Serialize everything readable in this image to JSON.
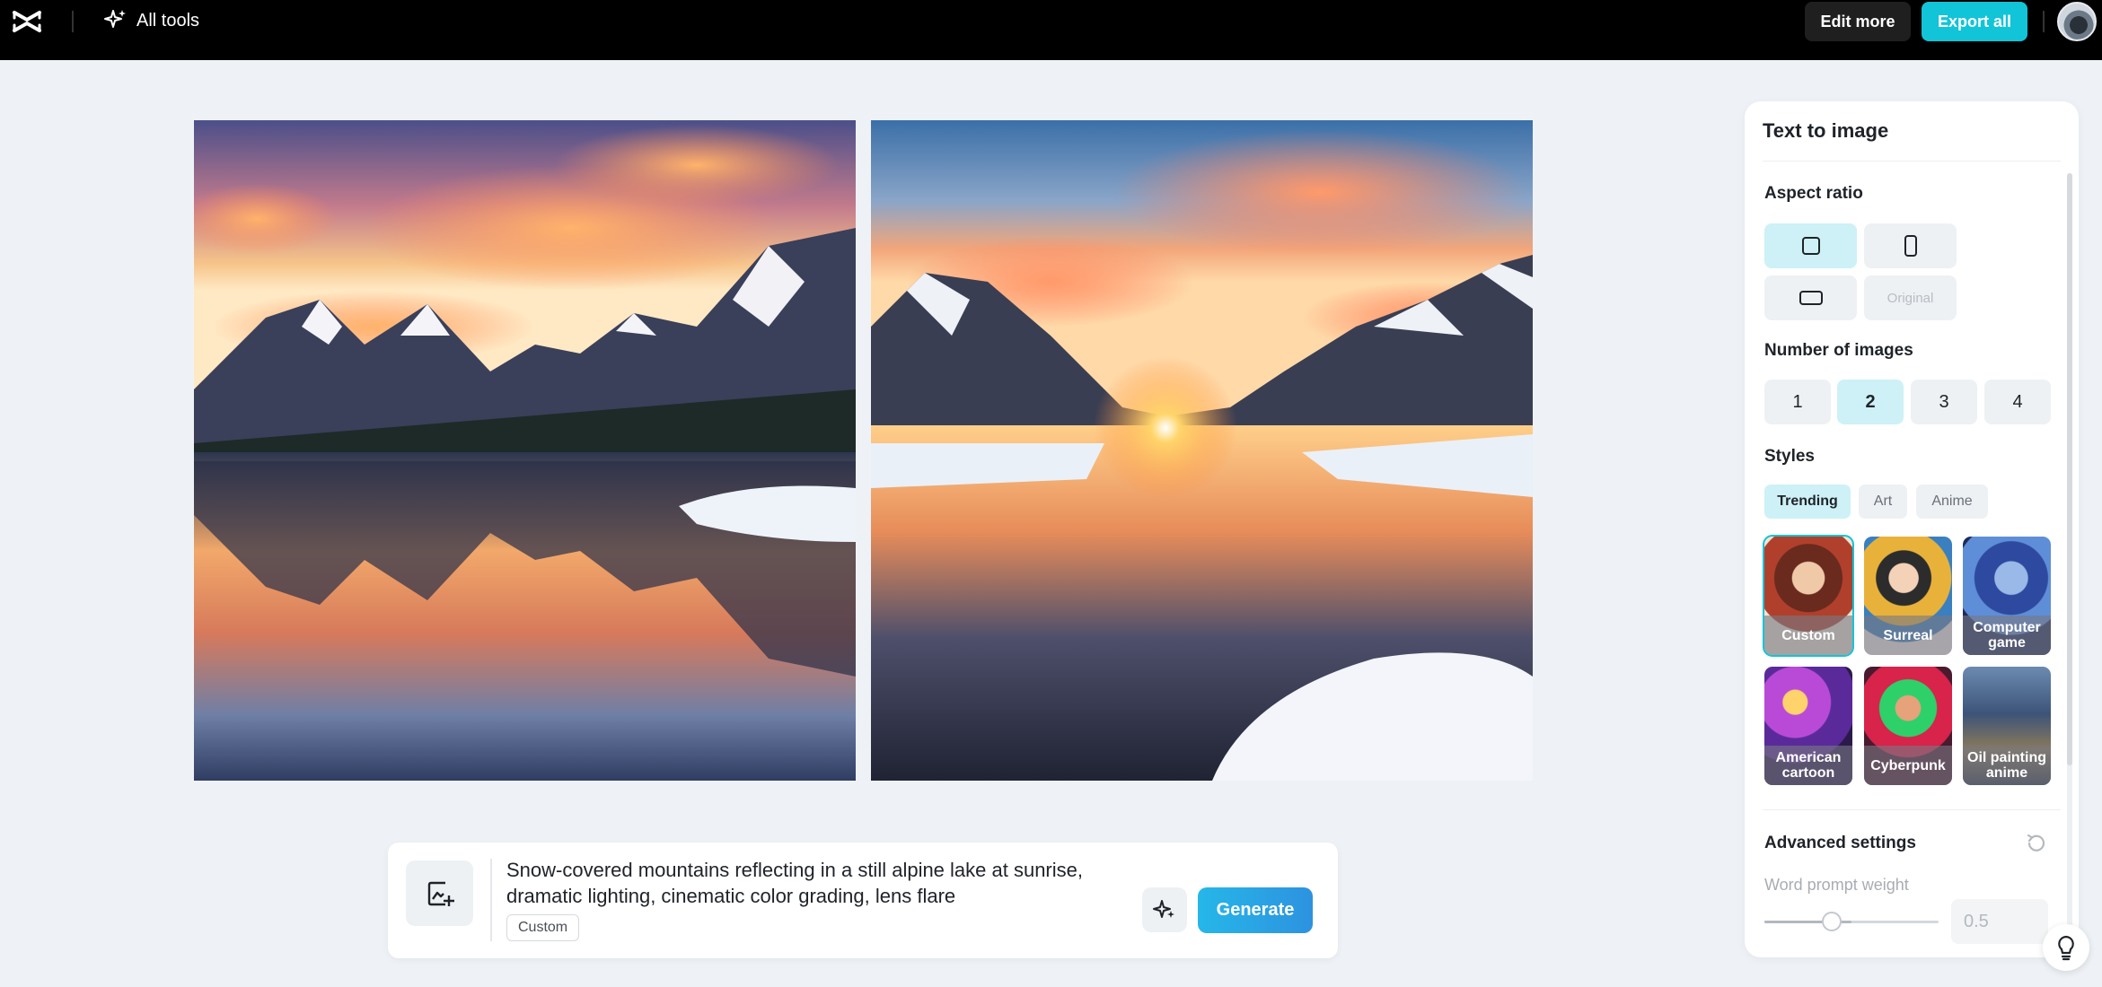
{
  "header": {
    "all_tools_label": "All tools",
    "edit_more_label": "Edit more",
    "export_all_label": "Export all"
  },
  "prompt": {
    "text": "Snow-covered mountains reflecting in a still alpine lake at sunrise, dramatic lighting, cinematic color grading, lens flare",
    "style_tag": "Custom",
    "generate_label": "Generate"
  },
  "panel": {
    "title": "Text to image",
    "aspect_ratio": {
      "label": "Aspect ratio",
      "options": [
        "square",
        "portrait",
        "landscape",
        "Original"
      ],
      "selected": "square"
    },
    "number_of_images": {
      "label": "Number of images",
      "options": [
        "1",
        "2",
        "3",
        "4"
      ],
      "selected": "2"
    },
    "styles": {
      "label": "Styles",
      "tabs": [
        "Trending",
        "Art",
        "Anime"
      ],
      "active_tab": "Trending",
      "cards": [
        "Custom",
        "Surreal",
        "Computer game",
        "American cartoon",
        "Cyberpunk",
        "Oil painting anime"
      ],
      "selected_card": "Custom"
    },
    "advanced": {
      "label": "Advanced settings",
      "word_prompt_weight_label": "Word prompt weight",
      "word_prompt_weight_value": "0.5"
    }
  },
  "colors": {
    "accent": "#12c4d8",
    "selected_bg": "#cdf1f6",
    "topbar": "#000000",
    "canvas": "#eef2f6"
  }
}
